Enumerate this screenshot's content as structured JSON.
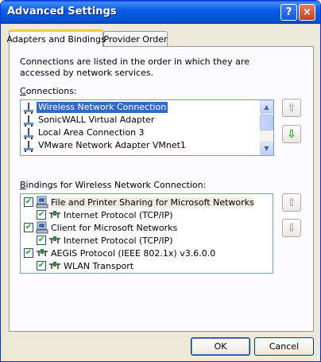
{
  "window": {
    "title": "Advanced Settings",
    "help_label": "?",
    "close_label": "×"
  },
  "tabs": [
    {
      "label": "Adapters and Bindings",
      "active": true
    },
    {
      "label": "Provider Order",
      "active": false
    }
  ],
  "adapters": {
    "description": "Connections are listed in the order in which they are accessed by network services.",
    "connections_label": "Connections:",
    "connections": [
      {
        "name": "Wireless Network Connection",
        "selected": true
      },
      {
        "name": "SonicWALL Virtual Adapter",
        "selected": false
      },
      {
        "name": "Local Area Connection 3",
        "selected": false
      },
      {
        "name": "VMware Network Adapter VMnet1",
        "selected": false
      }
    ],
    "bindings_label": "Bindings for Wireless Network Connection:",
    "bindings": [
      {
        "name": "File and Printer Sharing for Microsoft Networks",
        "checked": true,
        "level": 0,
        "icon": "computer-icon"
      },
      {
        "name": "Internet Protocol (TCP/IP)",
        "checked": true,
        "level": 1,
        "icon": "protocol-icon"
      },
      {
        "name": "Client for Microsoft Networks",
        "checked": true,
        "level": 0,
        "icon": "computer-icon"
      },
      {
        "name": "Internet Protocol (TCP/IP)",
        "checked": true,
        "level": 1,
        "icon": "protocol-icon"
      },
      {
        "name": "AEGIS Protocol (IEEE 802.1x) v3.6.0.0",
        "checked": true,
        "level": 0,
        "icon": "protocol-icon"
      },
      {
        "name": "WLAN Transport",
        "checked": true,
        "level": 1,
        "icon": "protocol-icon"
      }
    ]
  },
  "buttons": {
    "ok": "OK",
    "cancel": "Cancel"
  },
  "colors": {
    "selection": "#316ac5",
    "titlebar": "#0453d6",
    "dialog_bg": "#ece9d8",
    "move_down_arrow": "#1fa01f"
  }
}
